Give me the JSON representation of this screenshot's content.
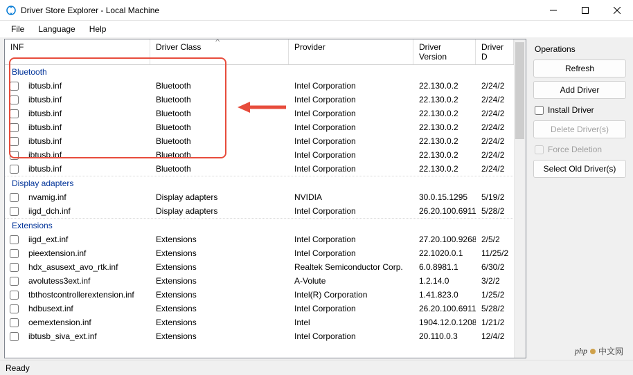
{
  "window": {
    "title": "Driver Store Explorer - Local Machine"
  },
  "menu": {
    "file": "File",
    "language": "Language",
    "help": "Help"
  },
  "columns": {
    "inf": "INF",
    "class": "Driver Class",
    "provider": "Provider",
    "version": "Driver Version",
    "date": "Driver D"
  },
  "groups": [
    {
      "name": "Bluetooth",
      "rows": [
        {
          "inf": "ibtusb.inf",
          "class": "Bluetooth",
          "provider": "Intel Corporation",
          "version": "22.130.0.2",
          "date": "2/24/2"
        },
        {
          "inf": "ibtusb.inf",
          "class": "Bluetooth",
          "provider": "Intel Corporation",
          "version": "22.130.0.2",
          "date": "2/24/2"
        },
        {
          "inf": "ibtusb.inf",
          "class": "Bluetooth",
          "provider": "Intel Corporation",
          "version": "22.130.0.2",
          "date": "2/24/2"
        },
        {
          "inf": "ibtusb.inf",
          "class": "Bluetooth",
          "provider": "Intel Corporation",
          "version": "22.130.0.2",
          "date": "2/24/2"
        },
        {
          "inf": "ibtusb.inf",
          "class": "Bluetooth",
          "provider": "Intel Corporation",
          "version": "22.130.0.2",
          "date": "2/24/2"
        },
        {
          "inf": "ibtusb.inf",
          "class": "Bluetooth",
          "provider": "Intel Corporation",
          "version": "22.130.0.2",
          "date": "2/24/2"
        },
        {
          "inf": "ibtusb.inf",
          "class": "Bluetooth",
          "provider": "Intel Corporation",
          "version": "22.130.0.2",
          "date": "2/24/2"
        }
      ]
    },
    {
      "name": "Display adapters",
      "rows": [
        {
          "inf": "nvamig.inf",
          "class": "Display adapters",
          "provider": "NVIDIA",
          "version": "30.0.15.1295",
          "date": "5/19/2"
        },
        {
          "inf": "iigd_dch.inf",
          "class": "Display adapters",
          "provider": "Intel Corporation",
          "version": "26.20.100.6911",
          "date": "5/28/2"
        }
      ]
    },
    {
      "name": "Extensions",
      "rows": [
        {
          "inf": "iigd_ext.inf",
          "class": "Extensions",
          "provider": "Intel Corporation",
          "version": "27.20.100.9268",
          "date": "2/5/2"
        },
        {
          "inf": "pieextension.inf",
          "class": "Extensions",
          "provider": "Intel Corporation",
          "version": "22.1020.0.1",
          "date": "11/25/2"
        },
        {
          "inf": "hdx_asusext_avo_rtk.inf",
          "class": "Extensions",
          "provider": "Realtek Semiconductor Corp.",
          "version": "6.0.8981.1",
          "date": "6/30/2"
        },
        {
          "inf": "avolutess3ext.inf",
          "class": "Extensions",
          "provider": "A-Volute",
          "version": "1.2.14.0",
          "date": "3/2/2"
        },
        {
          "inf": "tbthostcontrollerextension.inf",
          "class": "Extensions",
          "provider": "Intel(R) Corporation",
          "version": "1.41.823.0",
          "date": "1/25/2"
        },
        {
          "inf": "hdbusext.inf",
          "class": "Extensions",
          "provider": "Intel Corporation",
          "version": "26.20.100.6911",
          "date": "5/28/2"
        },
        {
          "inf": "oemextension.inf",
          "class": "Extensions",
          "provider": "Intel",
          "version": "1904.12.0.1208",
          "date": "1/21/2"
        },
        {
          "inf": "ibtusb_siva_ext.inf",
          "class": "Extensions",
          "provider": "Intel Corporation",
          "version": "20.110.0.3",
          "date": "12/4/2"
        }
      ]
    }
  ],
  "side": {
    "title": "Operations",
    "refresh": "Refresh",
    "addDriver": "Add Driver",
    "installDriver": "Install Driver",
    "deleteDrivers": "Delete Driver(s)",
    "forceDeletion": "Force Deletion",
    "selectOld": "Select Old Driver(s)"
  },
  "status": {
    "ready": "Ready"
  },
  "watermark": {
    "text": "中文网"
  }
}
